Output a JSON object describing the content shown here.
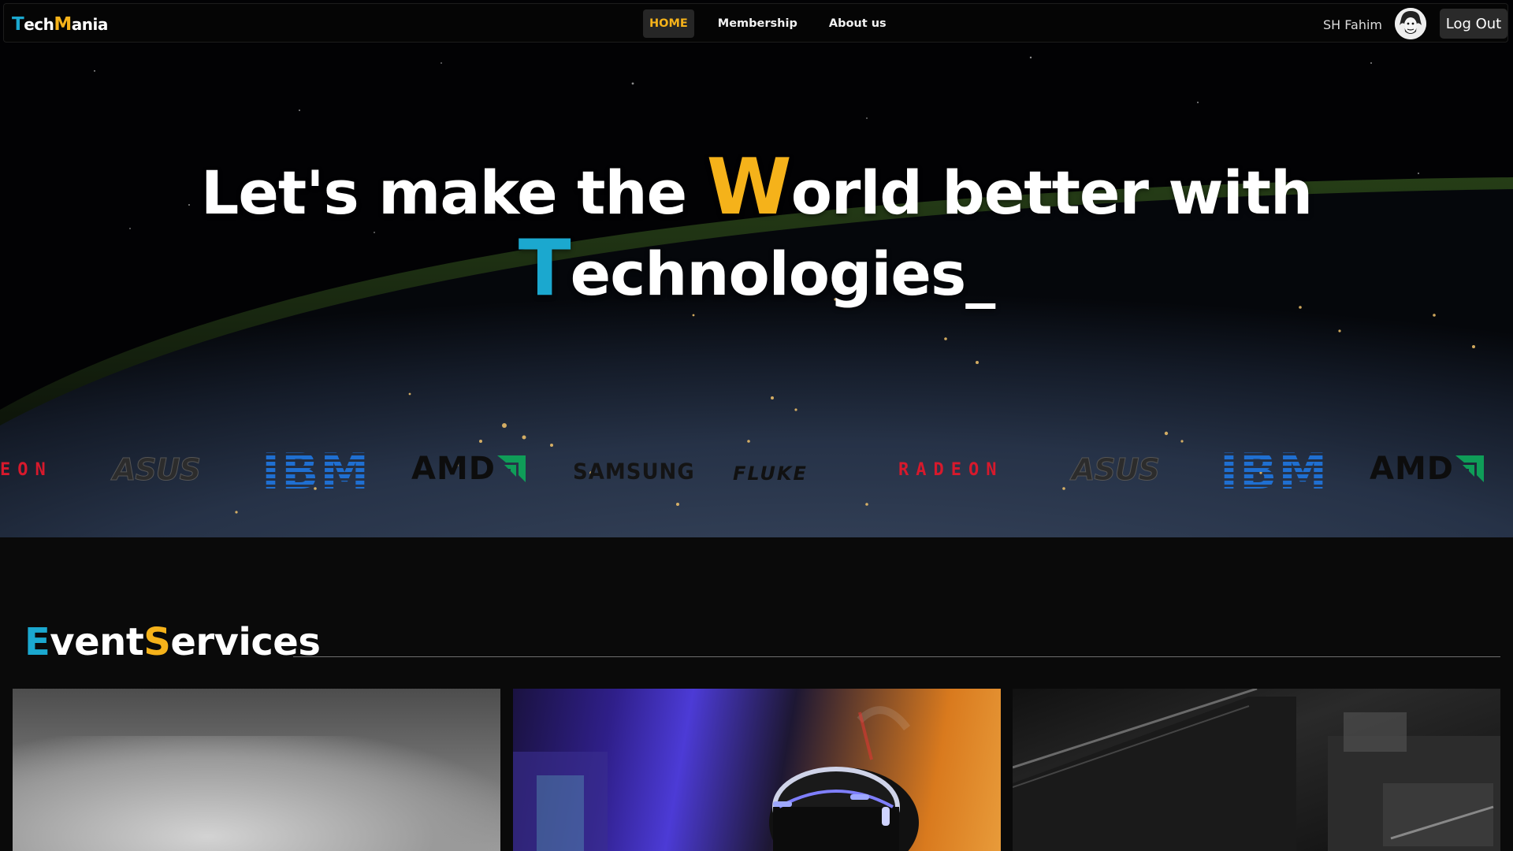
{
  "brand": {
    "t": "T",
    "ech": "ech",
    "m": "M",
    "ania": "ania"
  },
  "nav": {
    "items": [
      {
        "label": "HOME",
        "active": true
      },
      {
        "label": "Membership",
        "active": false
      },
      {
        "label": "About us",
        "active": false
      }
    ]
  },
  "user": {
    "name": "SH Fahim",
    "logout_label": "Log Out"
  },
  "hero": {
    "line1_pre": "Let's make the ",
    "line1_cap": "W",
    "line1_post": "orld better with",
    "line2_cap": "T",
    "line2_post": "echnologies",
    "cursor": "_"
  },
  "logos": {
    "radeon_partial": "EON",
    "asus": "ASUS",
    "ibm": "IBM",
    "amd": "AMD",
    "samsung": "SAMSUNG",
    "fluke": "FLUKE",
    "radeon": "RADEON"
  },
  "section": {
    "e": "E",
    "vent": "vent",
    "s": "S",
    "ervices": "ervices"
  },
  "colors": {
    "accent_blue": "#1ba8cf",
    "accent_yellow": "#f5b21a",
    "radeon_red": "#d7192c",
    "ibm_blue": "#1f6fd1",
    "amd_green": "#0f9d58"
  }
}
